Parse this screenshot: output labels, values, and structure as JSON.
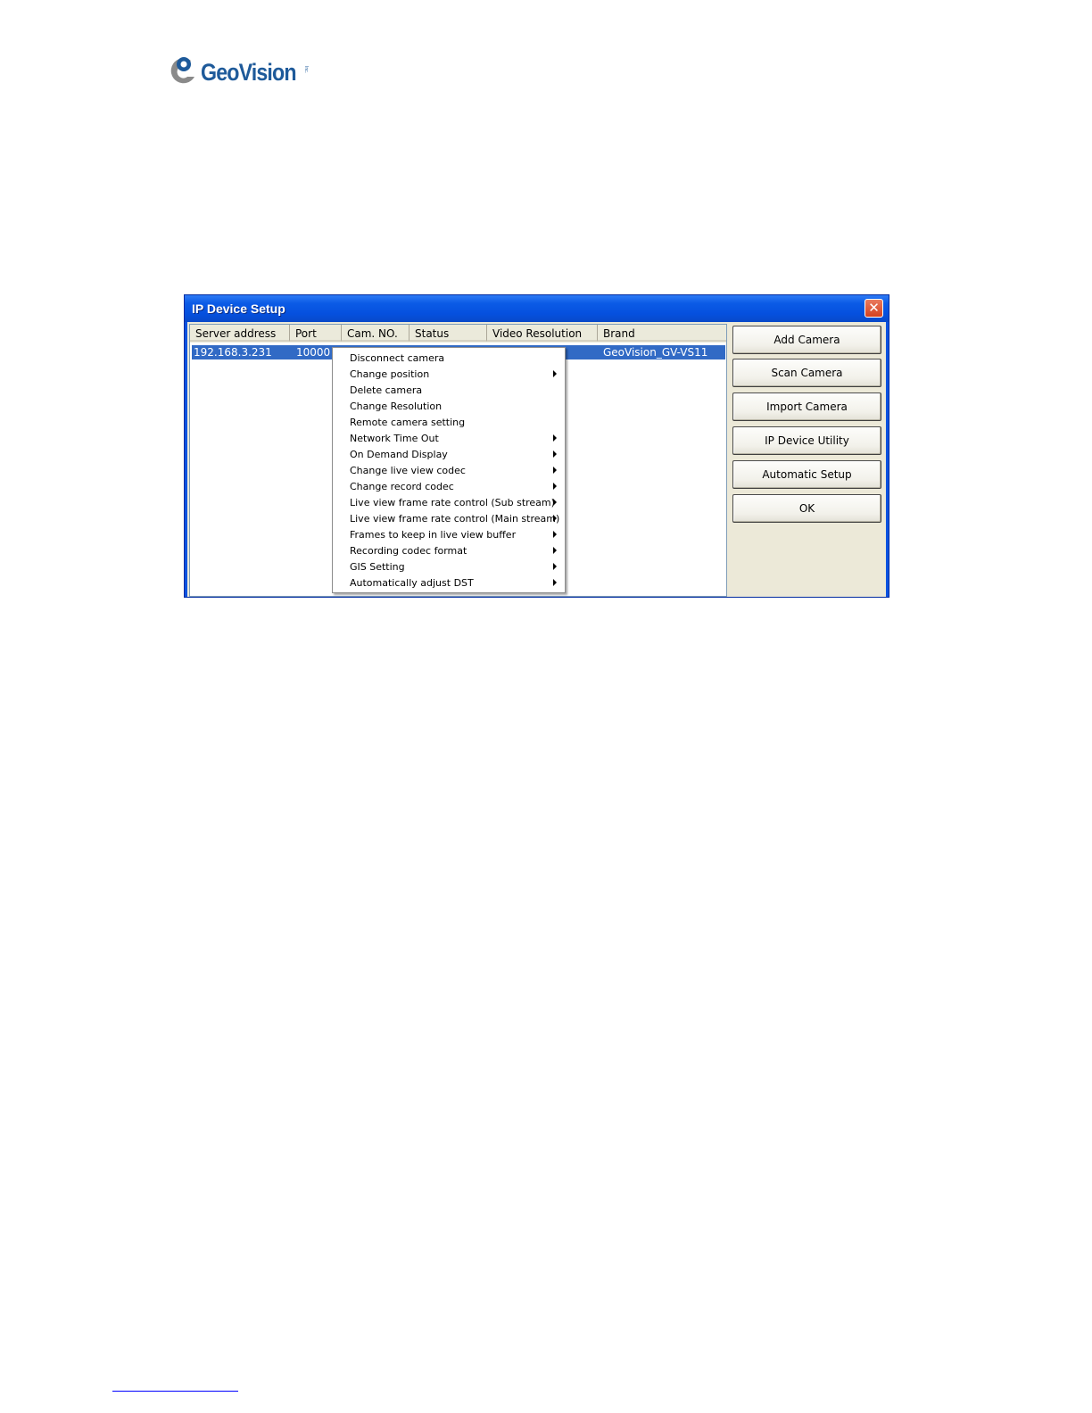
{
  "logo": {
    "text": "GeoVision",
    "sup": "Inc."
  },
  "window": {
    "title": "IP Device Setup",
    "close_glyph": "✕"
  },
  "table": {
    "columns": [
      "Server address",
      "Port",
      "Cam. NO.",
      "Status",
      "Video Resolution",
      "Brand"
    ],
    "rows": [
      {
        "server": "192.168.3.231",
        "port": "10000",
        "brand": "GeoVision_GV-VS11"
      }
    ]
  },
  "buttons": [
    "Add Camera",
    "Scan Camera",
    "Import Camera",
    "IP Device Utility",
    "Automatic Setup",
    "OK"
  ],
  "context_menu": {
    "items": [
      {
        "label": "Disconnect camera",
        "submenu": false
      },
      {
        "label": "Change position",
        "submenu": true
      },
      {
        "label": "Delete camera",
        "submenu": false
      },
      {
        "label": "Change Resolution",
        "submenu": false
      },
      {
        "label": "Remote camera setting",
        "submenu": false
      },
      {
        "label": "Network Time Out",
        "submenu": true
      },
      {
        "label": "On Demand Display",
        "submenu": true
      },
      {
        "label": "Change live view codec",
        "submenu": true
      },
      {
        "label": "Change record codec",
        "submenu": true
      },
      {
        "label": "Live view frame rate control (Sub stream)",
        "submenu": true
      },
      {
        "label": "Live view frame rate control (Main stream)",
        "submenu": true
      },
      {
        "label": "Frames to keep in live view buffer",
        "submenu": true
      },
      {
        "label": "Recording codec format",
        "submenu": true
      },
      {
        "label": "GIS Setting",
        "submenu": true
      },
      {
        "label": "Automatically adjust DST",
        "submenu": true
      }
    ]
  }
}
